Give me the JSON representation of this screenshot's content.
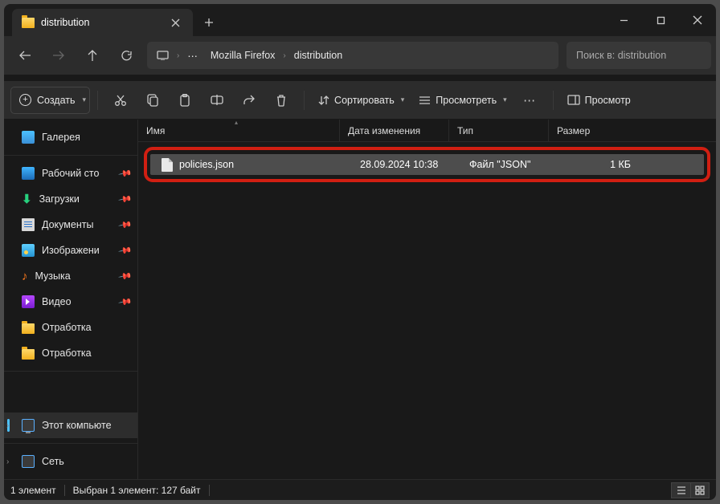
{
  "tab": {
    "title": "distribution"
  },
  "breadcrumb": {
    "parts": [
      "Mozilla Firefox",
      "distribution"
    ]
  },
  "search": {
    "placeholder": "Поиск в: distribution"
  },
  "toolbar": {
    "new_label": "Создать",
    "sort_label": "Сортировать",
    "view_label": "Просмотреть",
    "preview_label": "Просмотр"
  },
  "columns": {
    "name": "Имя",
    "date": "Дата изменения",
    "type": "Тип",
    "size": "Размер"
  },
  "sidebar": {
    "gallery": "Галерея",
    "desktop": "Рабочий сто",
    "downloads": "Загрузки",
    "documents": "Документы",
    "pictures": "Изображени",
    "music": "Музыка",
    "video": "Видео",
    "work1": "Отработка",
    "work2": "Отработка",
    "thispc": "Этот компьюте",
    "network": "Сеть"
  },
  "file": {
    "name": "policies.json",
    "date": "28.09.2024 10:38",
    "type": "Файл \"JSON\"",
    "size": "1 КБ"
  },
  "status": {
    "count": "1 элемент",
    "selected": "Выбран 1 элемент: 127 байт"
  }
}
